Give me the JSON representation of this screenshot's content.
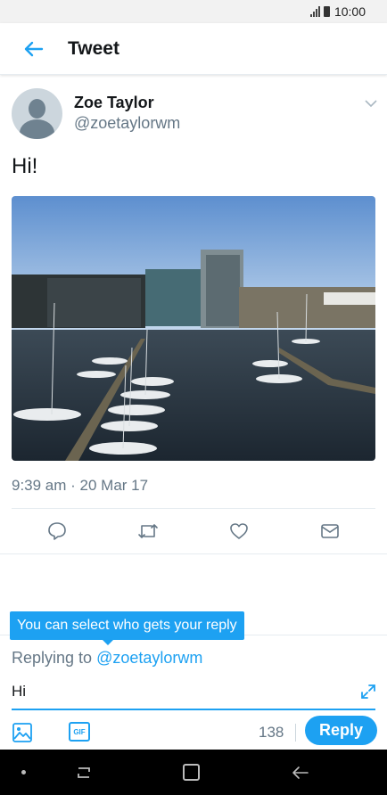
{
  "status": {
    "time": "10:00"
  },
  "header": {
    "title": "Tweet"
  },
  "tweet": {
    "author_name": "Zoe Taylor",
    "author_handle": "@zoetaylorwm",
    "text": "Hi!",
    "timestamp": "9:39 am · 20 Mar 17"
  },
  "reply": {
    "tooltip": "You can select who gets your reply",
    "replying_prefix": "Replying to ",
    "replying_handle": "@zoetaylorwm",
    "compose_value": "Hi",
    "char_count": "138",
    "gif_label": "GIF",
    "button_label": "Reply"
  },
  "colors": {
    "accent": "#1da1f2",
    "muted": "#657786"
  },
  "icons": [
    "back-arrow-icon",
    "chevron-down-icon",
    "reply-icon",
    "retweet-icon",
    "like-icon",
    "dm-icon",
    "expand-icon",
    "image-icon",
    "gif-icon"
  ]
}
